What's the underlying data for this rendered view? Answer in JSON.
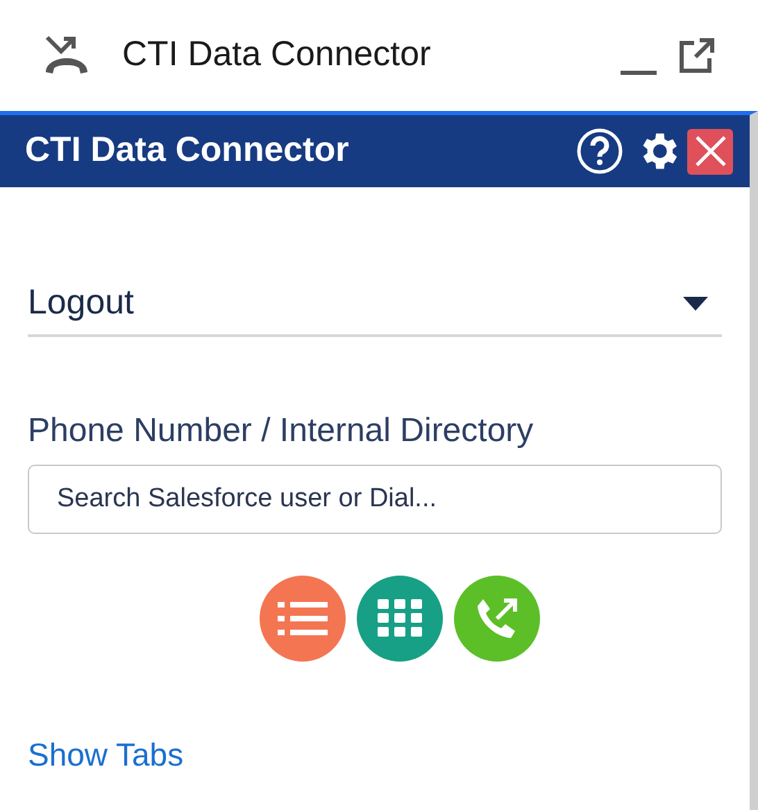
{
  "window": {
    "title": "CTI Data Connector"
  },
  "header": {
    "title": "CTI Data Connector"
  },
  "status_select": {
    "value": "Logout"
  },
  "dial": {
    "label": "Phone Number / Internal Directory",
    "placeholder": "Search Salesforce user or Dial..."
  },
  "show_tabs_link": "Show Tabs"
}
